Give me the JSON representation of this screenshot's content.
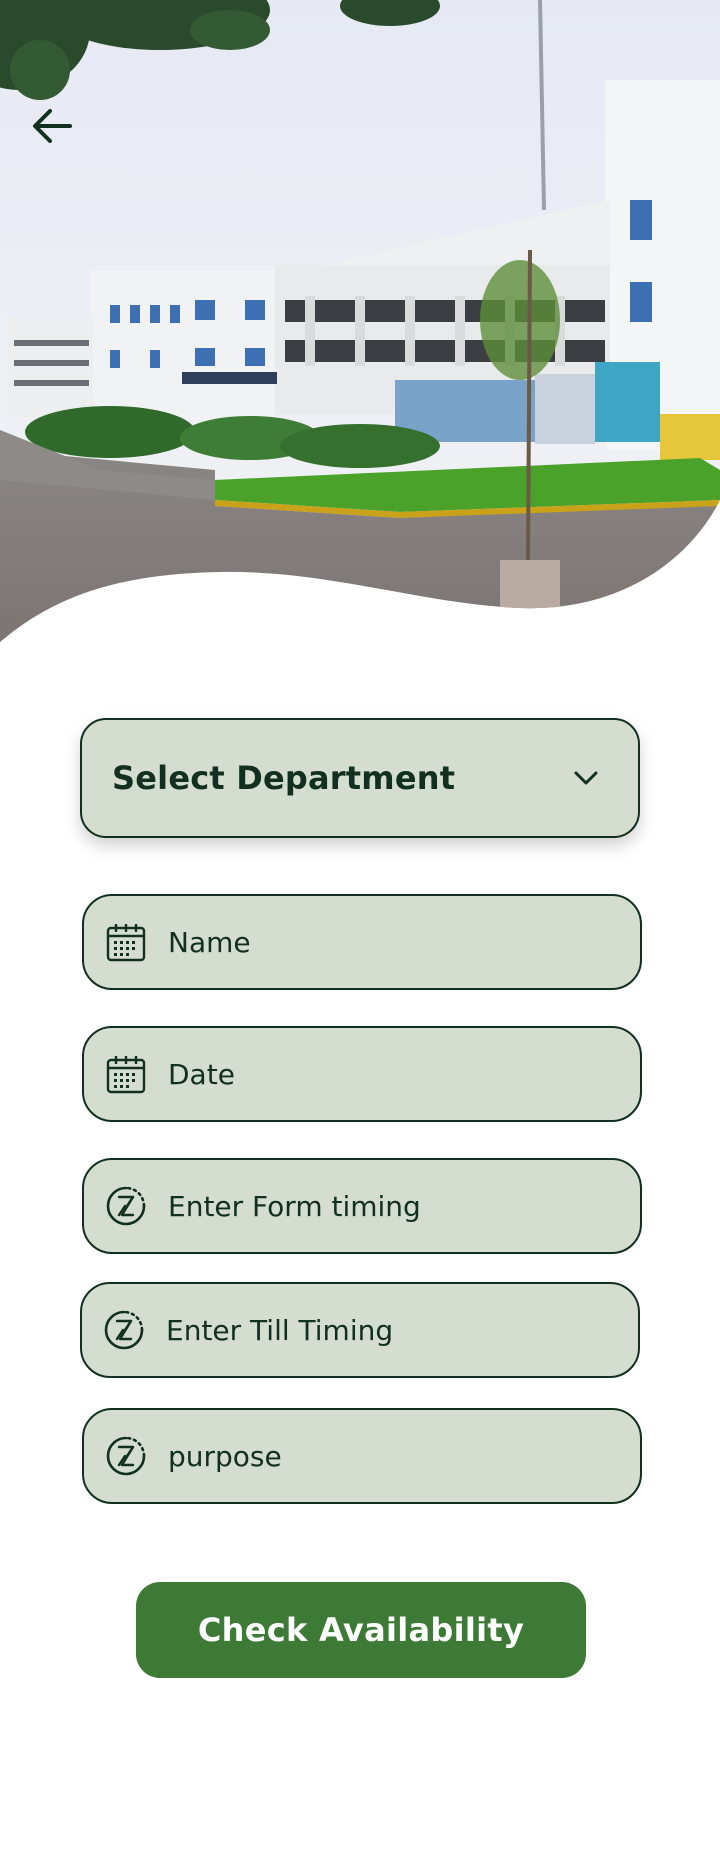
{
  "header": {
    "back_icon": "arrow-left-icon",
    "image_subject": "campus-building-photo"
  },
  "form": {
    "department_select": {
      "label": "Select Department",
      "icon": "chevron-down-icon"
    },
    "fields": {
      "name": {
        "placeholder": "Name",
        "icon": "calendar-icon"
      },
      "date": {
        "placeholder": "Date",
        "icon": "calendar-icon"
      },
      "from_timing": {
        "placeholder": "Enter Form timing",
        "icon": "hourglass-clock-icon"
      },
      "till_timing": {
        "placeholder": "Enter Till Timing",
        "icon": "hourglass-clock-icon"
      },
      "purpose": {
        "placeholder": "purpose",
        "icon": "hourglass-clock-icon"
      }
    },
    "submit_label": "Check Availability"
  },
  "colors": {
    "field_bg": "#d4ddd0",
    "field_border": "#12301f",
    "primary_button": "#3c7a36",
    "text_dark": "#12301f"
  }
}
